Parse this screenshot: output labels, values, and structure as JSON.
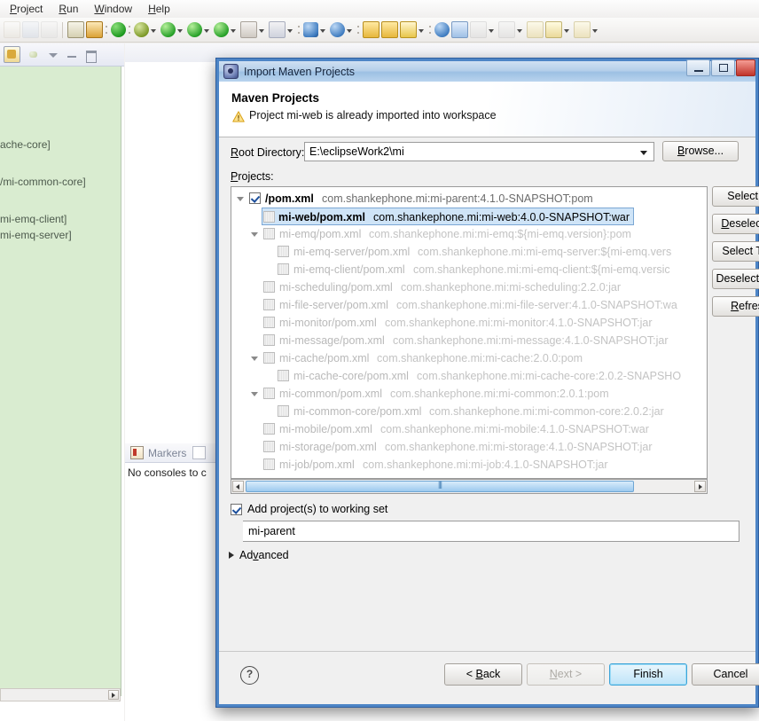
{
  "ide": {
    "menu": [
      {
        "label": "Project",
        "accel": "P"
      },
      {
        "label": "Run",
        "accel": "R"
      },
      {
        "label": "Window",
        "accel": "W"
      },
      {
        "label": "Help",
        "accel": "H"
      }
    ],
    "left_panel": {
      "rows": [
        "ache-core]",
        "/mi-common-core]",
        "mi-emq-client]",
        "mi-emq-server]"
      ]
    },
    "markers": {
      "tab_label": "Markers",
      "body_text": "No consoles to c"
    }
  },
  "dialog": {
    "title": "Import Maven Projects",
    "window_buttons": {
      "minimize": "minimize",
      "maximize": "maximize",
      "close": "close"
    },
    "header": {
      "heading": "Maven Projects",
      "message": "Project mi-web is already imported into workspace",
      "icon": "warning-icon"
    },
    "root_directory": {
      "label": "Root Directory:",
      "label_accel": "R",
      "value": "E:\\eclipseWork2\\mi",
      "browse_label": "Browse..."
    },
    "projects_label": "Projects:",
    "projects_label_accel": "P",
    "tree": [
      {
        "indent": 0,
        "twisty": "open",
        "check": "checked",
        "state": "root",
        "name": "/pom.xml",
        "coord": "com.shankephone.mi:mi-parent:4.1.0-SNAPSHOT:pom"
      },
      {
        "indent": 1,
        "twisty": "none",
        "check": "dim",
        "state": "selected",
        "name": "mi-web/pom.xml",
        "coord": "com.shankephone.mi:mi-web:4.0.0-SNAPSHOT:war"
      },
      {
        "indent": 1,
        "twisty": "open",
        "check": "dim",
        "state": "disabled",
        "name": "mi-emq/pom.xml",
        "coord": "com.shankephone.mi:mi-emq:${mi-emq.version}:pom"
      },
      {
        "indent": 2,
        "twisty": "none",
        "check": "dim",
        "state": "disabled",
        "name": "mi-emq-server/pom.xml",
        "coord": "com.shankephone.mi:mi-emq-server:${mi-emq.vers"
      },
      {
        "indent": 2,
        "twisty": "none",
        "check": "dim",
        "state": "disabled",
        "name": "mi-emq-client/pom.xml",
        "coord": "com.shankephone.mi:mi-emq-client:${mi-emq.versic"
      },
      {
        "indent": 1,
        "twisty": "none",
        "check": "dim",
        "state": "disabled",
        "name": "mi-scheduling/pom.xml",
        "coord": "com.shankephone.mi:mi-scheduling:2.2.0:jar"
      },
      {
        "indent": 1,
        "twisty": "none",
        "check": "dim",
        "state": "disabled",
        "name": "mi-file-server/pom.xml",
        "coord": "com.shankephone.mi:mi-file-server:4.1.0-SNAPSHOT:wa"
      },
      {
        "indent": 1,
        "twisty": "none",
        "check": "dim",
        "state": "disabled",
        "name": "mi-monitor/pom.xml",
        "coord": "com.shankephone.mi:mi-monitor:4.1.0-SNAPSHOT:jar"
      },
      {
        "indent": 1,
        "twisty": "none",
        "check": "dim",
        "state": "disabled",
        "name": "mi-message/pom.xml",
        "coord": "com.shankephone.mi:mi-message:4.1.0-SNAPSHOT:jar"
      },
      {
        "indent": 1,
        "twisty": "open",
        "check": "dim",
        "state": "disabled",
        "name": "mi-cache/pom.xml",
        "coord": "com.shankephone.mi:mi-cache:2.0.0:pom"
      },
      {
        "indent": 2,
        "twisty": "none",
        "check": "dim",
        "state": "disabled",
        "name": "mi-cache-core/pom.xml",
        "coord": "com.shankephone.mi:mi-cache-core:2.0.2-SNAPSHO"
      },
      {
        "indent": 1,
        "twisty": "open",
        "check": "dim",
        "state": "disabled",
        "name": "mi-common/pom.xml",
        "coord": "com.shankephone.mi:mi-common:2.0.1:pom"
      },
      {
        "indent": 2,
        "twisty": "none",
        "check": "dim",
        "state": "disabled",
        "name": "mi-common-core/pom.xml",
        "coord": "com.shankephone.mi:mi-common-core:2.0.2:jar"
      },
      {
        "indent": 1,
        "twisty": "none",
        "check": "dim",
        "state": "disabled",
        "name": "mi-mobile/pom.xml",
        "coord": "com.shankephone.mi:mi-mobile:4.1.0-SNAPSHOT:war"
      },
      {
        "indent": 1,
        "twisty": "none",
        "check": "dim",
        "state": "disabled",
        "name": "mi-storage/pom.xml",
        "coord": "com.shankephone.mi:mi-storage:4.1.0-SNAPSHOT:jar"
      },
      {
        "indent": 1,
        "twisty": "none",
        "check": "dim",
        "state": "disabled",
        "name": "mi-job/pom.xml",
        "coord": "com.shankephone.mi:mi-job:4.1.0-SNAPSHOT:jar"
      }
    ],
    "side_buttons": [
      {
        "label": "Select All",
        "accel": "A"
      },
      {
        "label": "Deselect All",
        "accel": "D"
      },
      {
        "label": "Select Tree",
        "accel": ""
      },
      {
        "label": "Deselect Tree",
        "accel": ""
      },
      {
        "label": "Refresh",
        "accel": "R"
      }
    ],
    "working_set": {
      "checkbox_label": "Add project(s) to working set",
      "checked": true,
      "value": "mi-parent"
    },
    "advanced": {
      "label": "Advanced",
      "accel": "v",
      "expanded": false
    },
    "footer": {
      "help": "?",
      "back": "< Back",
      "back_accel": "B",
      "next": "Next >",
      "next_accel": "N",
      "next_disabled": true,
      "finish": "Finish",
      "cancel": "Cancel"
    }
  },
  "colors": {
    "title_blue": "#4d85c6",
    "selection": "#cfe4f7",
    "left_panel_bg": "#d9ecd0",
    "default_button": "#bfe4f8"
  }
}
